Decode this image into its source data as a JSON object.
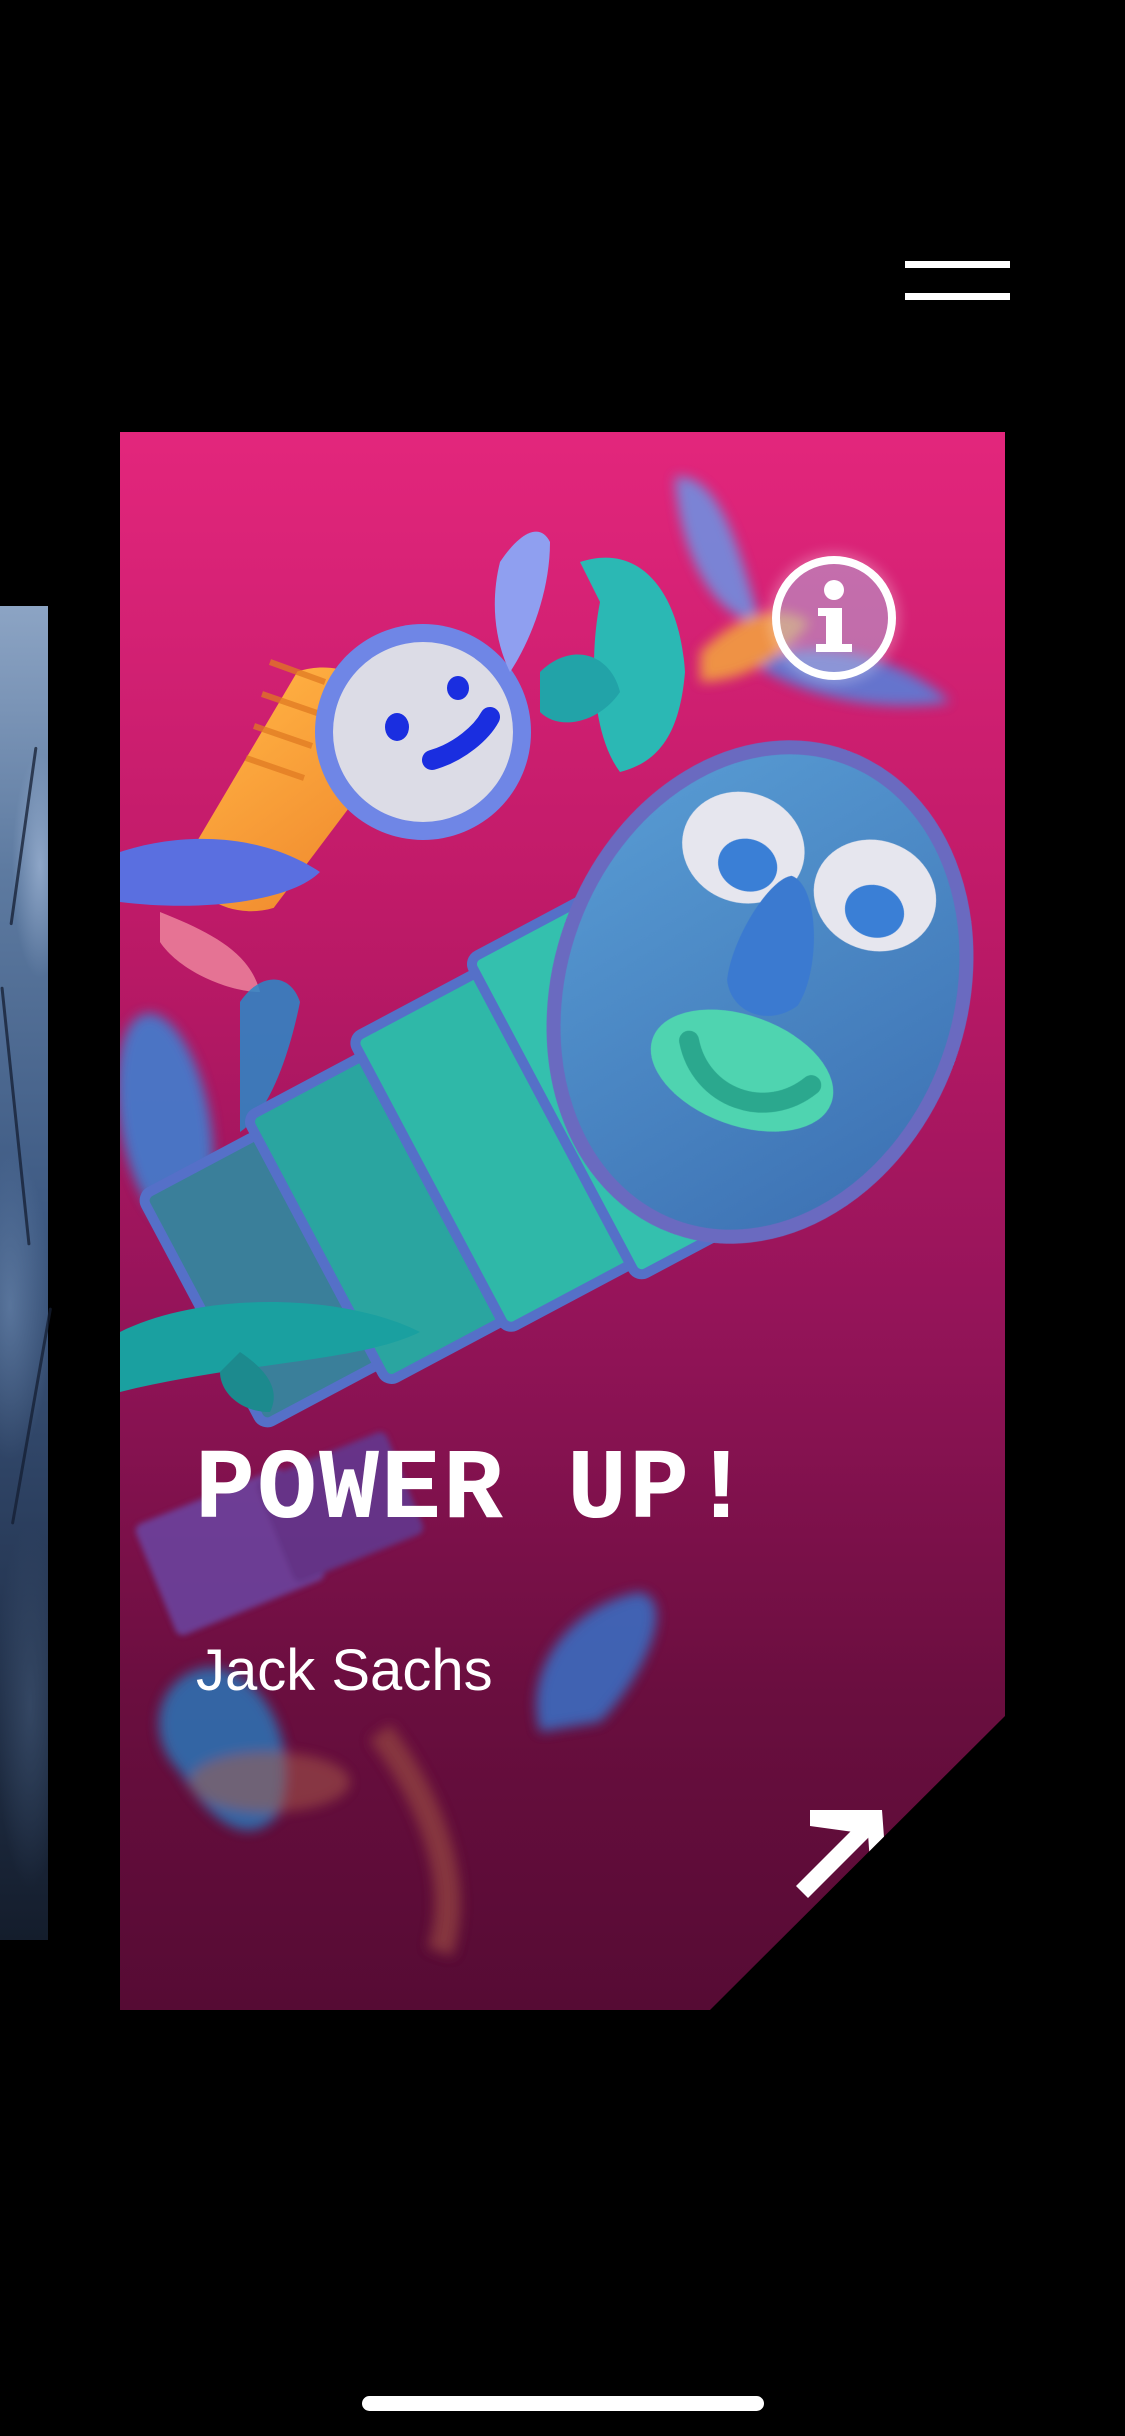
{
  "menu": {
    "icon": "hamburger-menu-icon"
  },
  "card": {
    "title": "POWER UP!",
    "author": "Jack Sachs",
    "info_icon": "info-icon",
    "open_icon": "arrow-up-right-icon",
    "colors": {
      "background_top": "#e3267c",
      "background_bottom": "#560b34",
      "foreground": "#ffffff"
    }
  },
  "previous_card": {
    "image": "dark-blue-artwork"
  }
}
